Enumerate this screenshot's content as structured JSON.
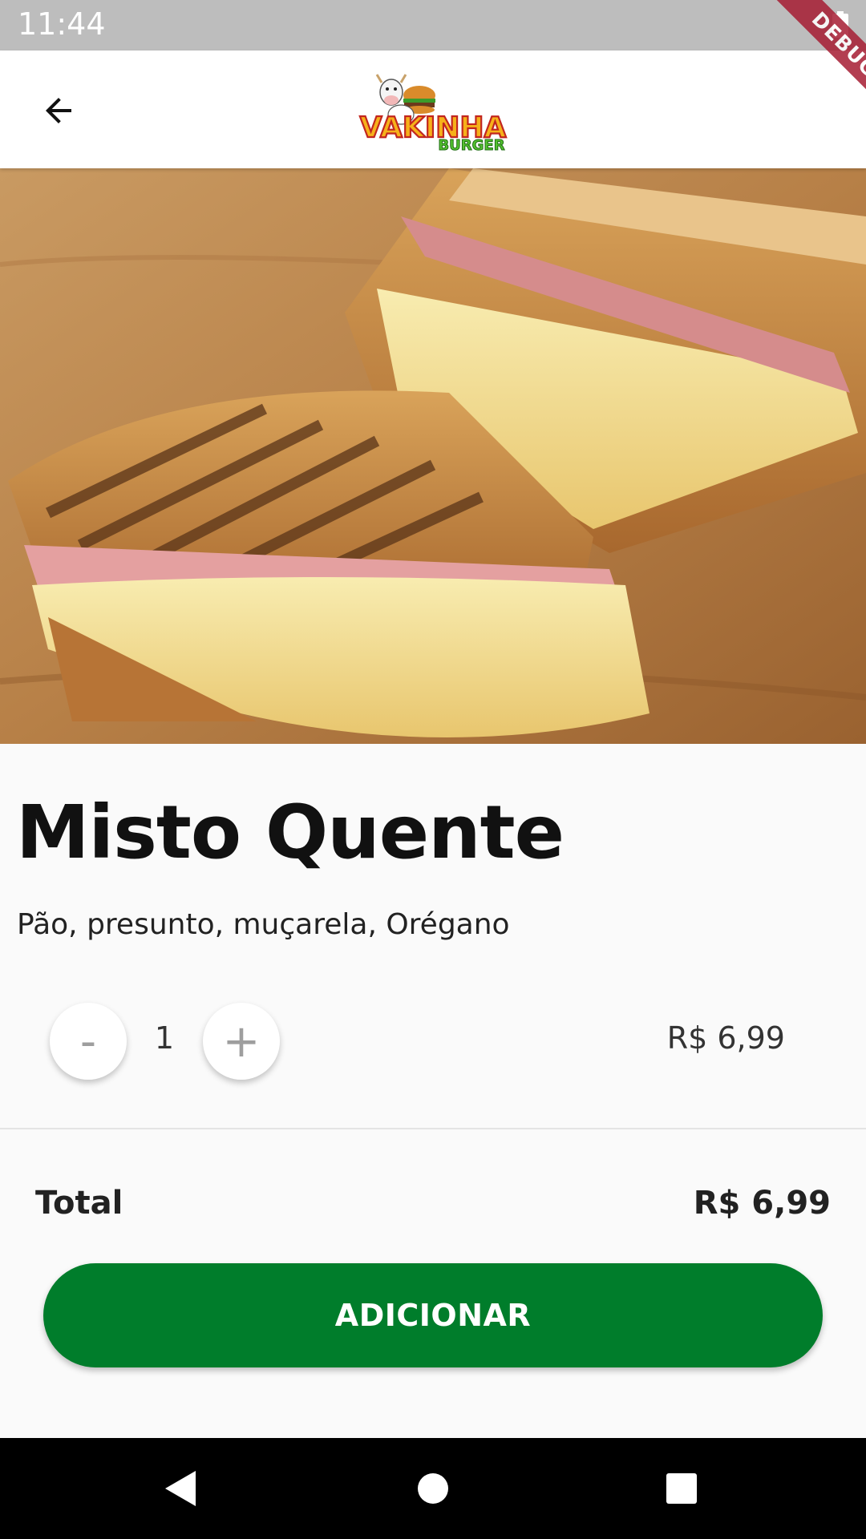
{
  "status_bar": {
    "time": "11:44"
  },
  "debug_banner": {
    "label": "DEBUG"
  },
  "app_bar": {
    "logo_main": "VAKINHA",
    "logo_sub": "BURGER"
  },
  "product": {
    "name": "Misto Quente",
    "description": "Pão, presunto, muçarela, Orégano",
    "quantity": "1",
    "unit_price": "R$ 6,99",
    "minus_label": "-",
    "plus_label": "+"
  },
  "summary": {
    "total_label": "Total",
    "total_value": "R$ 6,99"
  },
  "actions": {
    "add_label": "ADICIONAR"
  },
  "colors": {
    "accent": "#007d2b",
    "status_bar": "#bdbdbd",
    "debug": "#a61d33"
  }
}
